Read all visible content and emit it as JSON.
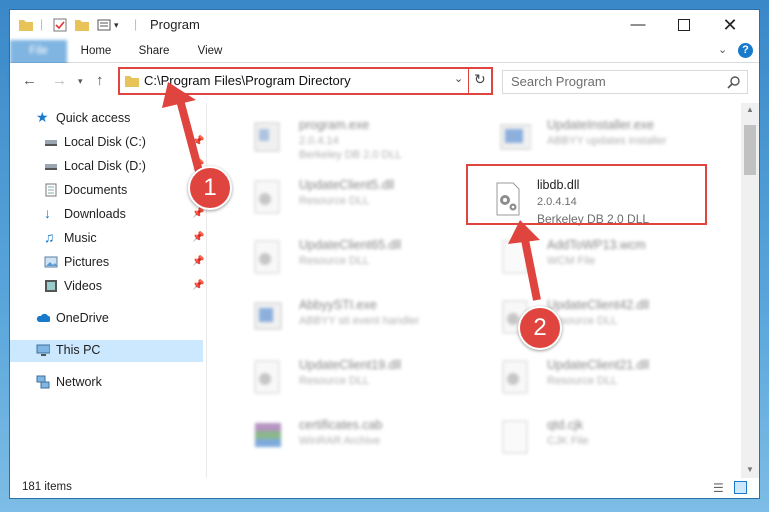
{
  "window": {
    "title": "Program"
  },
  "ribbon": {
    "tabs": [
      "File",
      "Home",
      "Share",
      "View"
    ]
  },
  "nav": {
    "address": "C:\\Program Files\\Program Directory",
    "search_placeholder": "Search Program"
  },
  "sidebar": {
    "items": [
      {
        "label": "Quick access",
        "icon": "star-icon"
      },
      {
        "label": "Local Disk (C:)",
        "icon": "drive-icon"
      },
      {
        "label": "Local Disk (D:)",
        "icon": "drive-icon"
      },
      {
        "label": "Documents",
        "icon": "documents-icon"
      },
      {
        "label": "Downloads",
        "icon": "download-icon"
      },
      {
        "label": "Music",
        "icon": "music-icon"
      },
      {
        "label": "Pictures",
        "icon": "pictures-icon"
      },
      {
        "label": "Videos",
        "icon": "videos-icon"
      },
      {
        "label": "OneDrive",
        "icon": "cloud-icon"
      },
      {
        "label": "This PC",
        "icon": "computer-icon"
      },
      {
        "label": "Network",
        "icon": "network-icon"
      }
    ]
  },
  "files": [
    {
      "name": "program.exe",
      "line2": "2.0.4.14",
      "line3": "Berkeley DB 2.0 DLL"
    },
    {
      "name": "UpdateInstaller.exe",
      "line2": "ABBYY updates installer",
      "line3": ""
    },
    {
      "name": "UpdateClient5.dll",
      "line2": "Resource DLL",
      "line3": ""
    },
    {
      "name": "libdb.dll",
      "line2": "2.0.4.14",
      "line3": "Berkeley DB 2.0 DLL"
    },
    {
      "name": "UpdateClient65.dll",
      "line2": "Resource DLL",
      "line3": ""
    },
    {
      "name": "AddToWP13.wcm",
      "line2": "WCM File",
      "line3": ""
    },
    {
      "name": "AbbyySTI.exe",
      "line2": "ABBYY sti event handler",
      "line3": ""
    },
    {
      "name": "UpdateClient42.dll",
      "line2": "Resource DLL",
      "line3": ""
    },
    {
      "name": "UpdateClient19.dll",
      "line2": "Resource DLL",
      "line3": ""
    },
    {
      "name": "UpdateClient21.dll",
      "line2": "Resource DLL",
      "line3": ""
    },
    {
      "name": "certificates.cab",
      "line2": "WinRAR Archive",
      "line3": ""
    },
    {
      "name": "qtd.cjk",
      "line2": "CJK File",
      "line3": ""
    }
  ],
  "status": {
    "count": "181 items"
  },
  "annotations": {
    "step1": "1",
    "step2": "2"
  },
  "colors": {
    "accent": "#1979ca",
    "highlight": "#e0443e",
    "selected": "#cce8ff"
  }
}
